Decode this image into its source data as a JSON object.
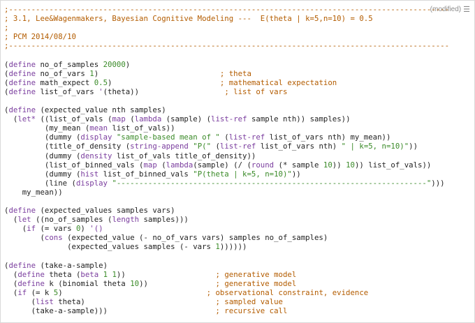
{
  "status": {
    "text": "(modified)",
    "menu_icon": "hamburger-menu-icon"
  },
  "colors": {
    "comment": "#b35c00",
    "keyword": "#7a3d9e",
    "string": "#3a8a28",
    "text": "#222222"
  },
  "lines": [
    [
      [
        "c",
        ";--------------------------------------------------------------------------------------------------"
      ]
    ],
    [
      [
        "c",
        "; 3.1, Lee&Wagenmakers, Bayesian Cognitive Modeling ---  E(theta | k=5,n=10) = 0.5"
      ]
    ],
    [
      [
        "c",
        ";"
      ]
    ],
    [
      [
        "c",
        "; PCM 2014/08/10"
      ]
    ],
    [
      [
        "c",
        ";--------------------------------------------------------------------------------------------------"
      ]
    ],
    [],
    [
      [
        "p",
        "("
      ],
      [
        "k",
        "define"
      ],
      [
        "p",
        " no_of_samples "
      ],
      [
        "s",
        "20000"
      ],
      [
        "p",
        ")"
      ]
    ],
    [
      [
        "p",
        "("
      ],
      [
        "k",
        "define"
      ],
      [
        "p",
        " no_of_vars "
      ],
      [
        "s",
        "1"
      ],
      [
        "p",
        ")                           "
      ],
      [
        "c",
        "; theta"
      ]
    ],
    [
      [
        "p",
        "("
      ],
      [
        "k",
        "define"
      ],
      [
        "p",
        " math_expect "
      ],
      [
        "s",
        "0.5"
      ],
      [
        "p",
        ")                        "
      ],
      [
        "c",
        "; mathematical expectation"
      ]
    ],
    [
      [
        "p",
        "("
      ],
      [
        "k",
        "define"
      ],
      [
        "p",
        " list_of_vars "
      ],
      [
        "q",
        "'"
      ],
      [
        "p",
        "(theta))                   "
      ],
      [
        "c",
        "; list of vars"
      ]
    ],
    [],
    [
      [
        "p",
        "("
      ],
      [
        "k",
        "define"
      ],
      [
        "p",
        " (expected_value nth samples)"
      ]
    ],
    [
      [
        "p",
        "  ("
      ],
      [
        "k",
        "let*"
      ],
      [
        "p",
        " ((list_of_vals ("
      ],
      [
        "k",
        "map"
      ],
      [
        "p",
        " ("
      ],
      [
        "k",
        "lambda"
      ],
      [
        "p",
        " (sample) ("
      ],
      [
        "k",
        "list-ref"
      ],
      [
        "p",
        " sample nth)) samples))"
      ]
    ],
    [
      [
        "p",
        "         (my_mean ("
      ],
      [
        "k",
        "mean"
      ],
      [
        "p",
        " list_of_vals))"
      ]
    ],
    [
      [
        "p",
        "         (dummy ("
      ],
      [
        "k",
        "display"
      ],
      [
        "p",
        " "
      ],
      [
        "s",
        "\"sample-based mean of \""
      ],
      [
        "p",
        " ("
      ],
      [
        "k",
        "list-ref"
      ],
      [
        "p",
        " list_of_vars nth) my_mean))"
      ]
    ],
    [
      [
        "p",
        "         (title_of_density ("
      ],
      [
        "k",
        "string-append"
      ],
      [
        "p",
        " "
      ],
      [
        "s",
        "\"P(\""
      ],
      [
        "p",
        " ("
      ],
      [
        "k",
        "list-ref"
      ],
      [
        "p",
        " list_of_vars nth) "
      ],
      [
        "s",
        "\" | k=5, n=10)\""
      ],
      [
        "p",
        "))"
      ]
    ],
    [
      [
        "p",
        "         (dummy ("
      ],
      [
        "k",
        "density"
      ],
      [
        "p",
        " list_of_vals title_of_density))"
      ]
    ],
    [
      [
        "p",
        "         (list_of_binned_vals ("
      ],
      [
        "k",
        "map"
      ],
      [
        "p",
        " ("
      ],
      [
        "k",
        "lambda"
      ],
      [
        "p",
        "(sample) (/ ("
      ],
      [
        "k",
        "round"
      ],
      [
        "p",
        " (* sample "
      ],
      [
        "s",
        "10"
      ],
      [
        "p",
        ")) "
      ],
      [
        "s",
        "10"
      ],
      [
        "p",
        ")) list_of_vals))"
      ]
    ],
    [
      [
        "p",
        "         (dummy ("
      ],
      [
        "k",
        "hist"
      ],
      [
        "p",
        " list_of_binned_vals "
      ],
      [
        "s",
        "\"P(theta | k=5, n=10)\""
      ],
      [
        "p",
        "))"
      ]
    ],
    [
      [
        "p",
        "         (line ("
      ],
      [
        "k",
        "display"
      ],
      [
        "p",
        " "
      ],
      [
        "s",
        "\"---------------------------------------------------------------------\""
      ],
      [
        "p",
        ")))"
      ]
    ],
    [
      [
        "p",
        "    my_mean))"
      ]
    ],
    [],
    [
      [
        "p",
        "("
      ],
      [
        "k",
        "define"
      ],
      [
        "p",
        " (expected_values samples vars)"
      ]
    ],
    [
      [
        "p",
        "  ("
      ],
      [
        "k",
        "let"
      ],
      [
        "p",
        " ((no_of_samples ("
      ],
      [
        "k",
        "length"
      ],
      [
        "p",
        " samples)))"
      ]
    ],
    [
      [
        "p",
        "    ("
      ],
      [
        "k",
        "if"
      ],
      [
        "p",
        " (= vars "
      ],
      [
        "s",
        "0"
      ],
      [
        "p",
        ") "
      ],
      [
        "q",
        "'()"
      ]
    ],
    [
      [
        "p",
        "        ("
      ],
      [
        "k",
        "cons"
      ],
      [
        "p",
        " (expected_value (- no_of_vars vars) samples no_of_samples)"
      ]
    ],
    [
      [
        "p",
        "              (expected_values samples (- vars "
      ],
      [
        "s",
        "1"
      ],
      [
        "p",
        "))))))"
      ]
    ],
    [],
    [
      [
        "p",
        "("
      ],
      [
        "k",
        "define"
      ],
      [
        "p",
        " (take-a-sample)"
      ]
    ],
    [
      [
        "p",
        "  ("
      ],
      [
        "k",
        "define"
      ],
      [
        "p",
        " theta ("
      ],
      [
        "k",
        "beta"
      ],
      [
        "p",
        " "
      ],
      [
        "s",
        "1"
      ],
      [
        "p",
        " "
      ],
      [
        "s",
        "1"
      ],
      [
        "p",
        "))                    "
      ],
      [
        "c",
        "; generative model"
      ]
    ],
    [
      [
        "p",
        "  ("
      ],
      [
        "k",
        "define"
      ],
      [
        "p",
        " k (binomial theta "
      ],
      [
        "s",
        "10"
      ],
      [
        "p",
        "))               "
      ],
      [
        "c",
        "; generative model"
      ]
    ],
    [
      [
        "p",
        "  ("
      ],
      [
        "k",
        "if"
      ],
      [
        "p",
        " (= k "
      ],
      [
        "s",
        "5"
      ],
      [
        "p",
        ")                                "
      ],
      [
        "c",
        "; observational constraint, evidence"
      ]
    ],
    [
      [
        "p",
        "      ("
      ],
      [
        "k",
        "list"
      ],
      [
        "p",
        " theta)                             "
      ],
      [
        "c",
        "; sampled value"
      ]
    ],
    [
      [
        "p",
        "      (take-a-sample)))                        "
      ],
      [
        "c",
        "; recursive call"
      ]
    ]
  ]
}
